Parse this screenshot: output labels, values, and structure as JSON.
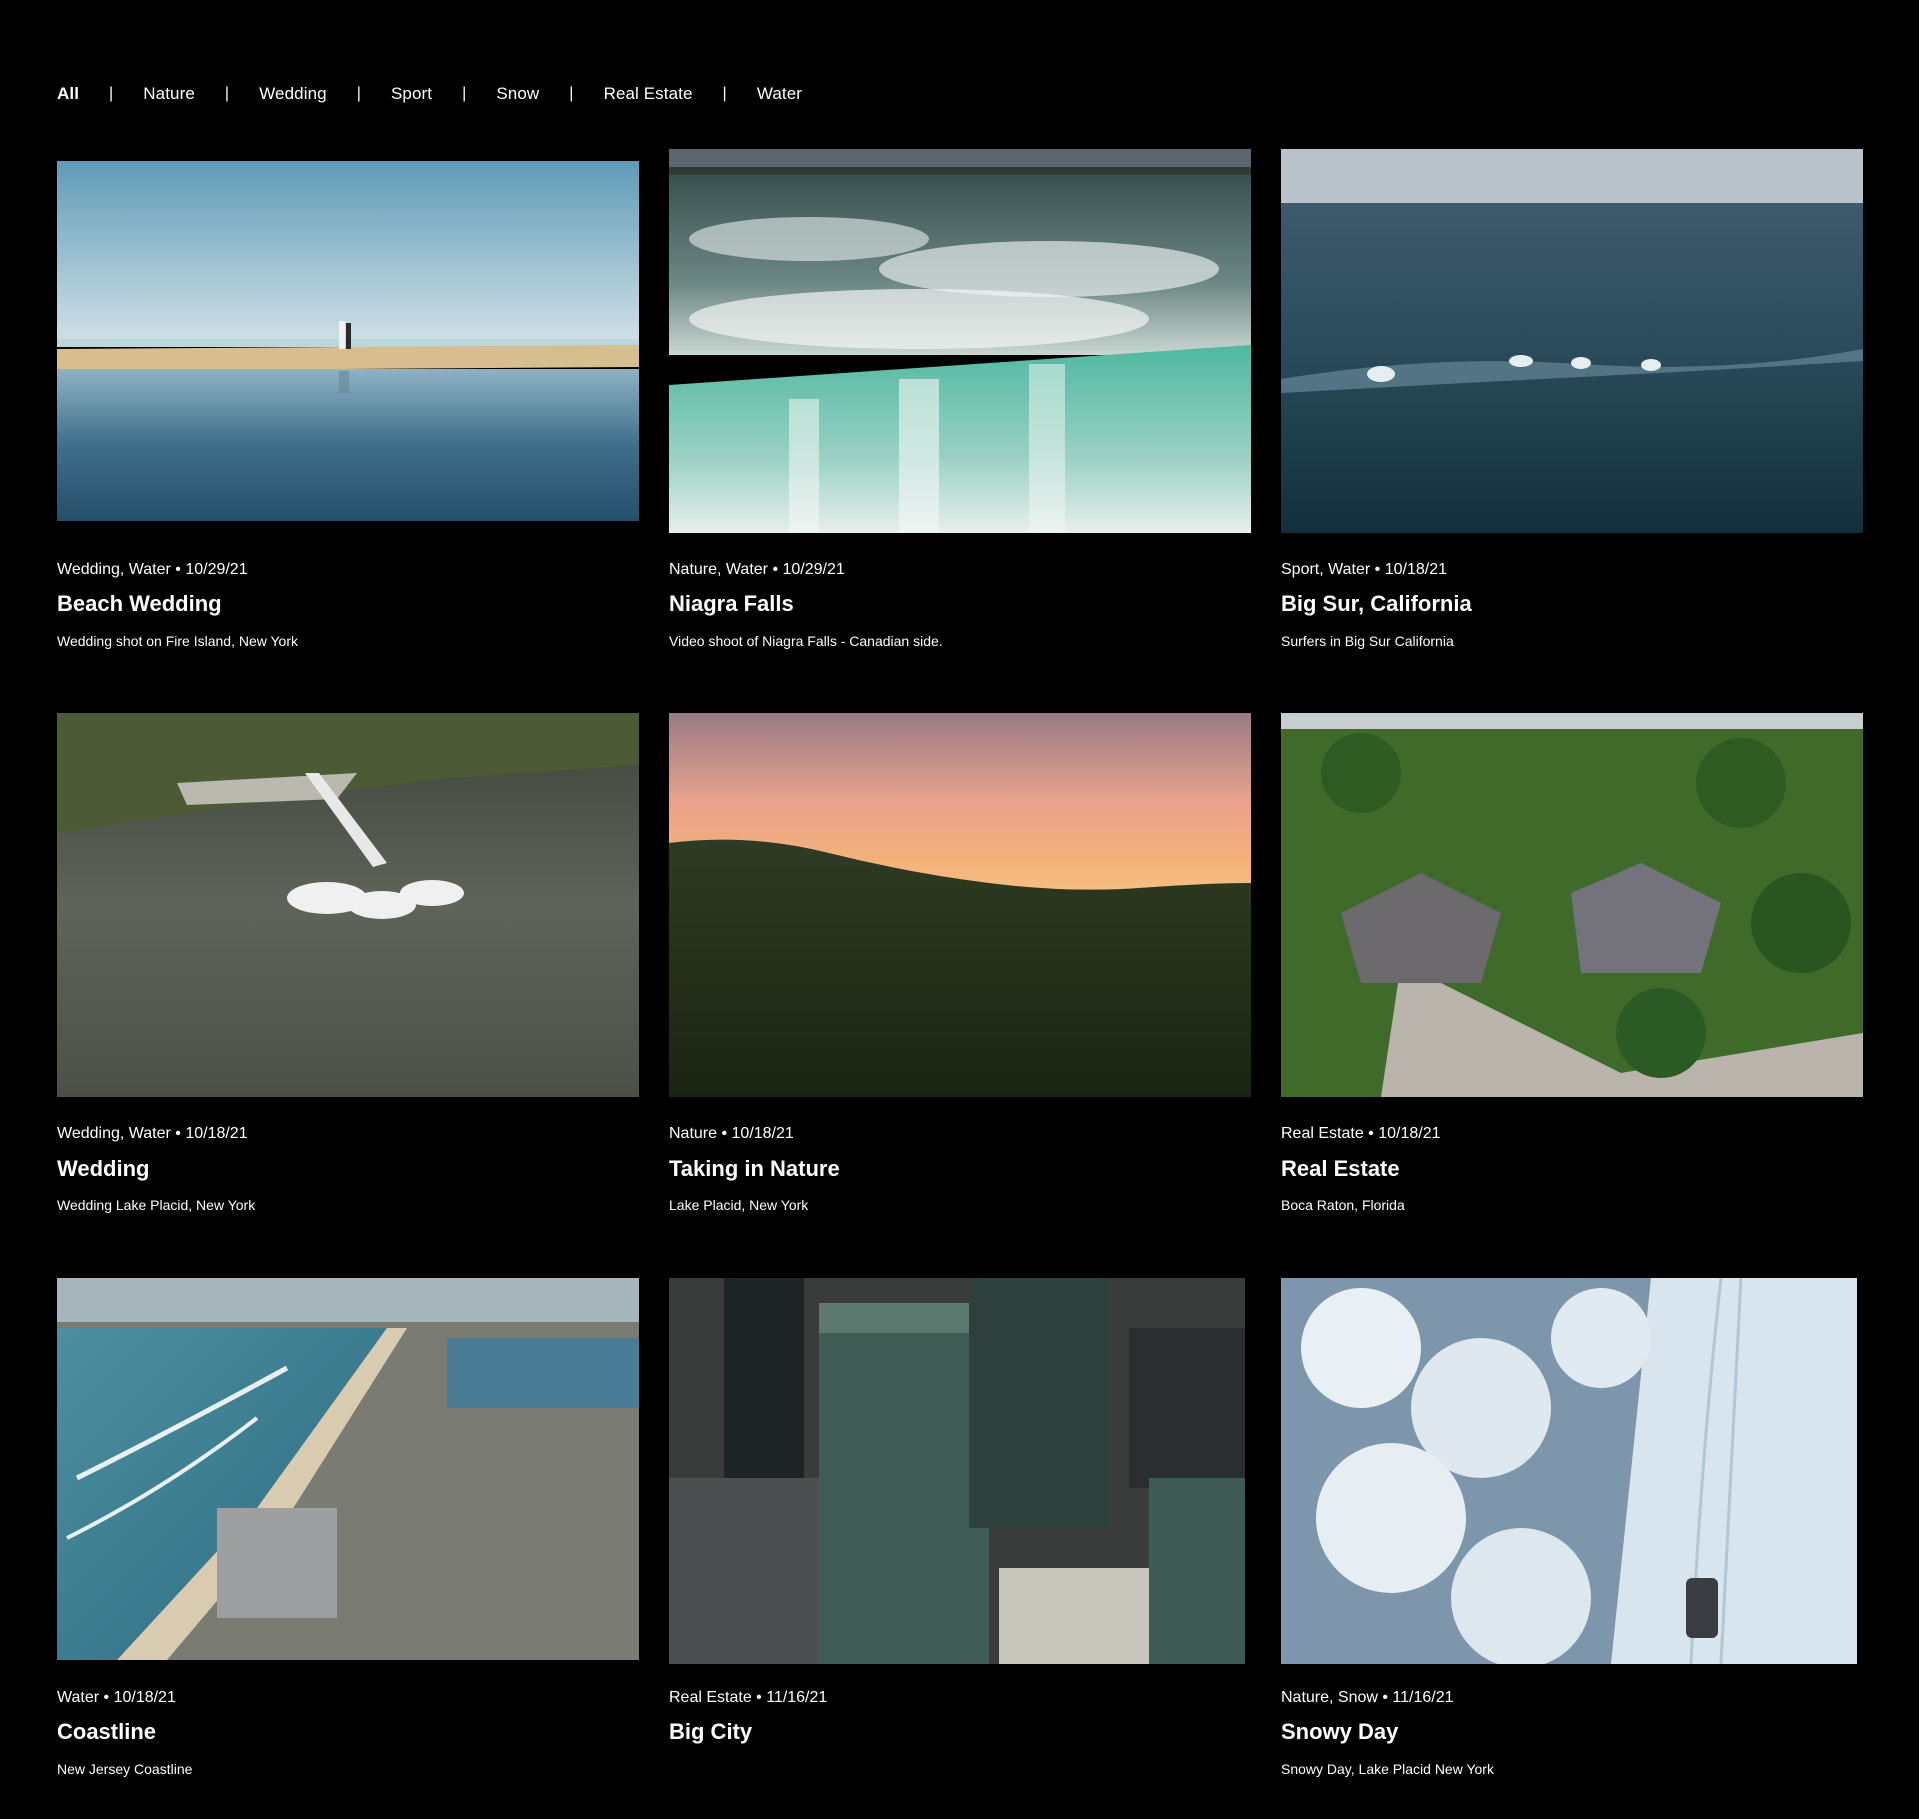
{
  "filters": {
    "items": [
      "All",
      "Nature",
      "Wedding",
      "Sport",
      "Snow",
      "Real Estate",
      "Water"
    ],
    "active": "All",
    "separator": "|"
  },
  "cards": [
    {
      "categories": "Wedding, Water",
      "date": "10/29/21",
      "meta": "Wedding, Water • 10/29/21",
      "title": "Beach Wedding",
      "description": "Wedding shot on Fire Island, New York"
    },
    {
      "categories": "Nature, Water",
      "date": "10/29/21",
      "meta": "Nature, Water • 10/29/21",
      "title": "Niagra Falls",
      "description": "Video shoot of Niagra Falls - Canadian side."
    },
    {
      "categories": "Sport, Water",
      "date": "10/18/21",
      "meta": "Sport, Water • 10/18/21",
      "title": "Big Sur, California",
      "description": "Surfers in Big Sur California"
    },
    {
      "categories": "Wedding, Water",
      "date": "10/18/21",
      "meta": "Wedding, Water • 10/18/21",
      "title": "Wedding",
      "description": "Wedding Lake Placid, New York"
    },
    {
      "categories": "Nature",
      "date": "10/18/21",
      "meta": "Nature • 10/18/21",
      "title": "Taking in Nature",
      "description": "Lake Placid, New York"
    },
    {
      "categories": "Real Estate",
      "date": "10/18/21",
      "meta": "Real Estate • 10/18/21",
      "title": "Real Estate",
      "description": "Boca Raton, Florida"
    },
    {
      "categories": "Water",
      "date": "10/18/21",
      "meta": "Water • 10/18/21",
      "title": "Coastline",
      "description": "New Jersey Coastline"
    },
    {
      "categories": "Real Estate",
      "date": "11/16/21",
      "meta": "Real Estate • 11/16/21",
      "title": "Big City",
      "description": ""
    },
    {
      "categories": "Nature, Snow",
      "date": "11/16/21",
      "meta": "Nature, Snow • 11/16/21",
      "title": "Snowy Day",
      "description": "Snowy Day, Lake Placid New York"
    }
  ],
  "colors": {
    "background": "#000000",
    "text": "#ffffff"
  }
}
